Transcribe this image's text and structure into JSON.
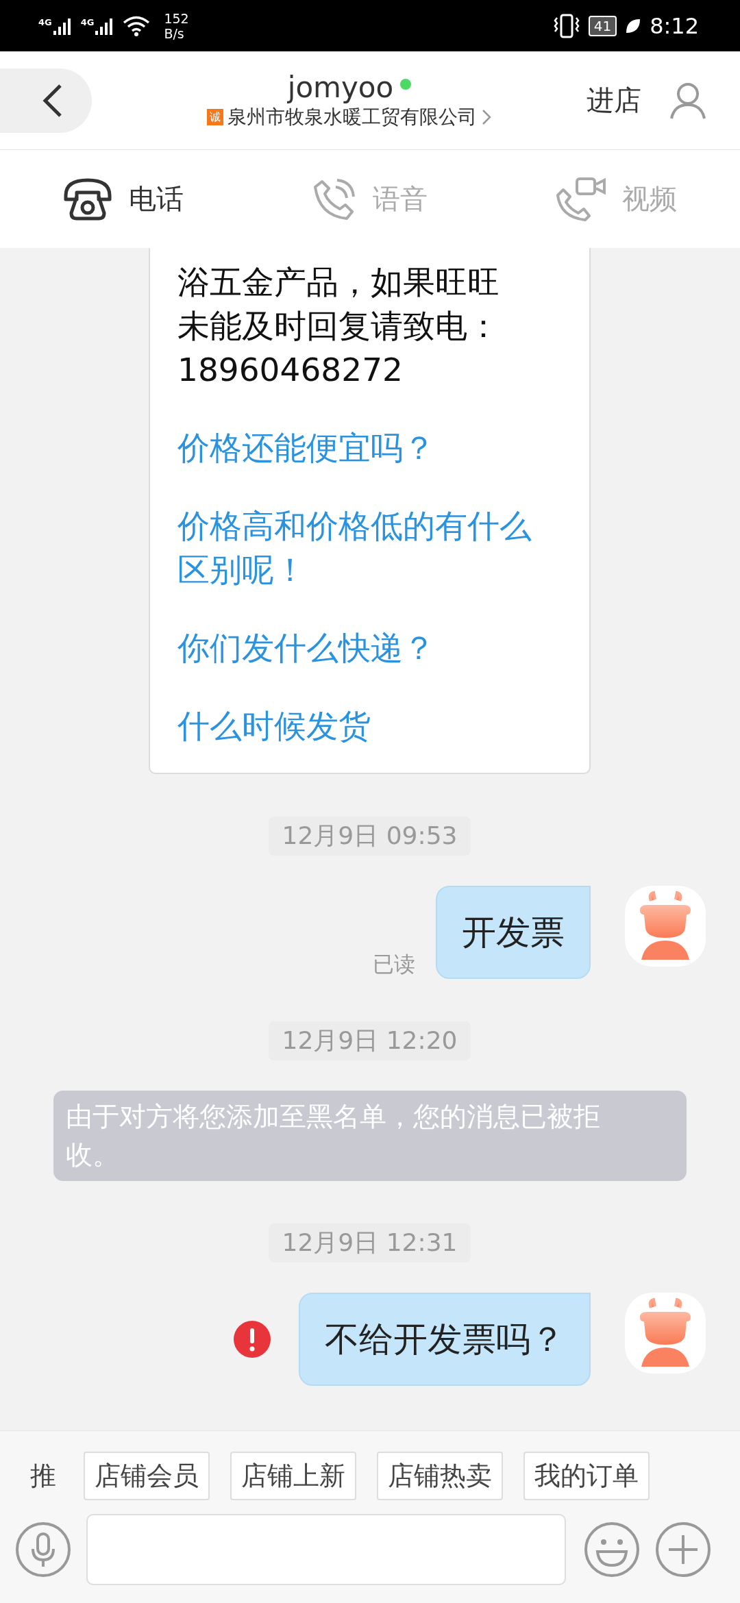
{
  "status_bar": {
    "networks": [
      "4G",
      "4G"
    ],
    "speed": [
      "152",
      "B/s"
    ],
    "battery": "41",
    "time": "8:12"
  },
  "header": {
    "title": "jomyoo",
    "online": true,
    "badge": "诚",
    "subtitle": "泉州市牧泉水暖工贸有限公司",
    "enter_shop": "进店"
  },
  "call_tabs": [
    {
      "kind": "phone",
      "label": "电话",
      "selected": true
    },
    {
      "kind": "voice",
      "label": "语音",
      "selected": false
    },
    {
      "kind": "video",
      "label": "视频",
      "selected": false
    }
  ],
  "messages": [
    {
      "kind": "card",
      "lines": [
        "浴五金产品，如果旺旺",
        "未能及时回复请致电：",
        "18960468272"
      ],
      "links": [
        "价格还能便宜吗？",
        "价格高和价格低的有什么区别呢！",
        "你们发什么快递？",
        "什么时候发货"
      ]
    },
    {
      "kind": "time",
      "text": "12月9日 09:53"
    },
    {
      "kind": "outgoing",
      "text": "开发票",
      "receipt": "已读",
      "failed": false
    },
    {
      "kind": "time",
      "text": "12月9日 12:20"
    },
    {
      "kind": "system",
      "text": "由于对方将您添加至黑名单，您的消息已被拒收。"
    },
    {
      "kind": "time",
      "text": "12月9日 12:31"
    },
    {
      "kind": "outgoing",
      "text": "不给开发票吗？",
      "failed": true
    }
  ],
  "bottom_bar": {
    "label": "推",
    "chips": [
      "店铺会员",
      "店铺上新",
      "店铺热卖",
      "我的订单"
    ]
  }
}
